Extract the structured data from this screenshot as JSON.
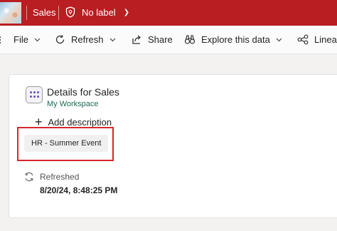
{
  "header": {
    "title": "Sales",
    "sensitivity_label": "No label",
    "colors": {
      "background": "#b81e22",
      "text": "#ffffff"
    }
  },
  "toolbar": {
    "file": "File",
    "refresh": "Refresh",
    "share": "Share",
    "explore": "Explore this data",
    "lineage": "Linea"
  },
  "details": {
    "title": "Details for Sales",
    "workspace": "My Workspace",
    "add_description": "Add description",
    "tag": "HR - Summer Event",
    "refreshed_label": "Refreshed",
    "refreshed_time": "8/20/24, 8:48:25 PM",
    "colors": {
      "workspace_link": "#1b6b57",
      "highlight": "#d6262b"
    }
  }
}
